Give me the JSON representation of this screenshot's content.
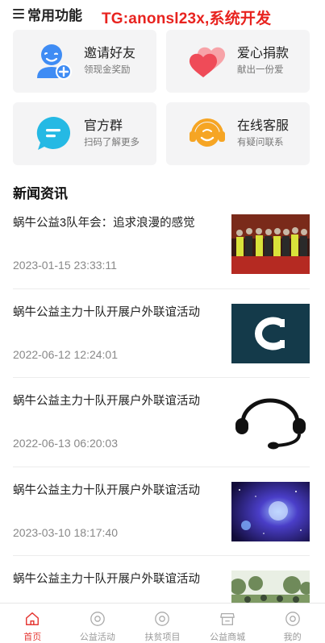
{
  "header": {
    "section_title": "常用功能",
    "watermark": "TG:anonsl23x,系统开发"
  },
  "features": [
    {
      "title": "邀请好友",
      "subtitle": "领现金奖励",
      "icon": "invite-user-icon",
      "color": "#3f8cf4"
    },
    {
      "title": "爱心捐款",
      "subtitle": "献出一份爱",
      "icon": "heart-icon",
      "color": "#ef4b58"
    },
    {
      "title": "官方群",
      "subtitle": "扫码了解更多",
      "icon": "chat-bubble-icon",
      "color": "#25b9e4"
    },
    {
      "title": "在线客服",
      "subtitle": "有疑问联系",
      "icon": "headset-icon",
      "color": "#f6a524"
    }
  ],
  "news": {
    "heading": "新闻资讯",
    "items": [
      {
        "title": "蜗牛公益3队年会：追求浪漫的感觉",
        "date": "2023-01-15 23:33:11",
        "thumb": "group-photo"
      },
      {
        "title": "蜗牛公益主力十队开展户外联谊活动",
        "date": "2022-06-12 12:24:01",
        "thumb": "letter-c-logo"
      },
      {
        "title": "蜗牛公益主力十队开展户外联谊活动",
        "date": "2022-06-13 06:20:03",
        "thumb": "headset-outline"
      },
      {
        "title": "蜗牛公益主力十队开展户外联谊活动",
        "date": "2023-03-10 18:17:40",
        "thumb": "space-art"
      },
      {
        "title": "蜗牛公益主力十队开展户外联谊活动",
        "date": "",
        "thumb": "outdoor-photo"
      }
    ]
  },
  "tabbar": {
    "active_color": "#e53935",
    "items": [
      {
        "label": "首页",
        "icon": "home-icon",
        "active": true
      },
      {
        "label": "公益活动",
        "icon": "target-icon",
        "active": false
      },
      {
        "label": "扶贫项目",
        "icon": "target-icon",
        "active": false
      },
      {
        "label": "公益商城",
        "icon": "store-icon",
        "active": false
      },
      {
        "label": "我的",
        "icon": "target-icon",
        "active": false
      }
    ]
  }
}
